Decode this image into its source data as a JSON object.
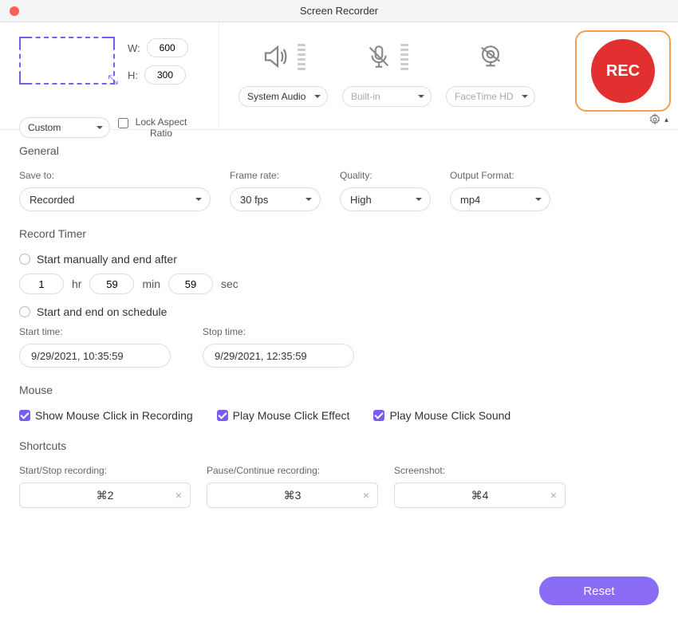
{
  "title": "Screen Recorder",
  "region": {
    "width_label": "W:",
    "height_label": "H:",
    "width_value": "600",
    "height_value": "300",
    "mode": "Custom",
    "lock_aspect_label": "Lock Aspect Ratio"
  },
  "sources": {
    "audio": "System Audio",
    "mic": "Built-in",
    "camera": "FaceTime HD"
  },
  "rec_button": "REC",
  "general": {
    "section": "General",
    "save_to_label": "Save to:",
    "save_to_value": "Recorded",
    "frame_rate_label": "Frame rate:",
    "frame_rate_value": "30 fps",
    "quality_label": "Quality:",
    "quality_value": "High",
    "output_format_label": "Output Format:",
    "output_format_value": "mp4"
  },
  "timer": {
    "section": "Record Timer",
    "manual_label": "Start manually and end after",
    "hr_value": "1",
    "hr_label": "hr",
    "min_value": "59",
    "min_label": "min",
    "sec_value": "59",
    "sec_label": "sec",
    "schedule_label": "Start and end on schedule",
    "start_time_label": "Start time:",
    "start_time_value": "9/29/2021, 10:35:59",
    "stop_time_label": "Stop time:",
    "stop_time_value": "9/29/2021, 12:35:59"
  },
  "mouse": {
    "section": "Mouse",
    "show_click": "Show Mouse Click in Recording",
    "play_effect": "Play Mouse Click Effect",
    "play_sound": "Play Mouse Click Sound"
  },
  "shortcuts": {
    "section": "Shortcuts",
    "start_stop_label": "Start/Stop recording:",
    "start_stop_value": "⌘2",
    "pause_label": "Pause/Continue recording:",
    "pause_value": "⌘3",
    "screenshot_label": "Screenshot:",
    "screenshot_value": "⌘4"
  },
  "reset_label": "Reset"
}
